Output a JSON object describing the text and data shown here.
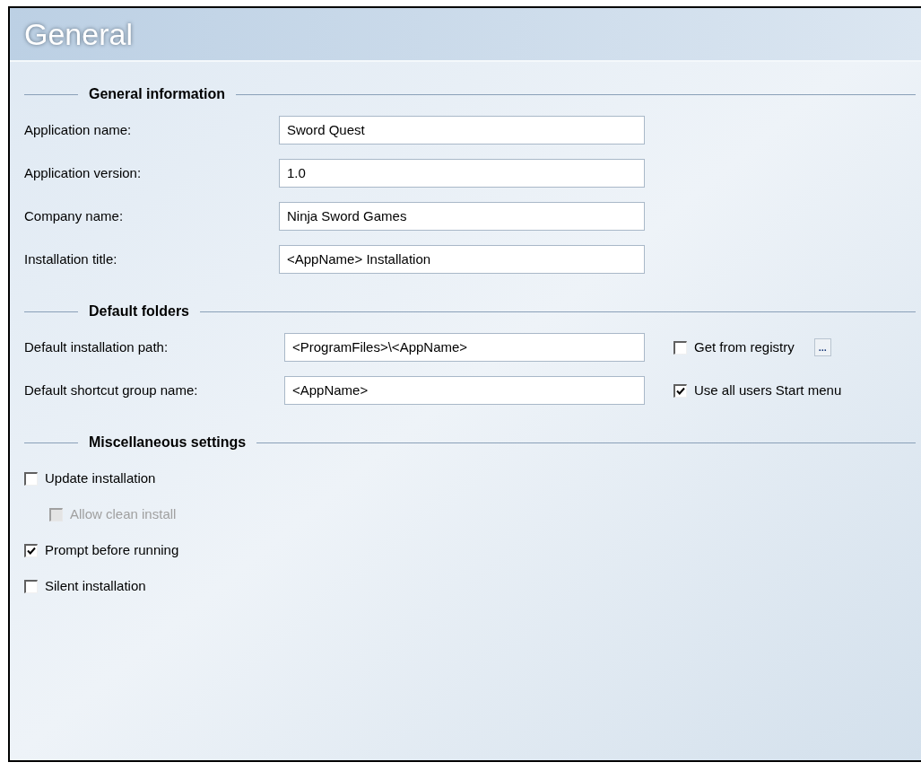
{
  "page": {
    "title": "General"
  },
  "general_information": {
    "heading": "General information",
    "fields": [
      {
        "label": "Application name:",
        "value": "Sword Quest"
      },
      {
        "label": "Application version:",
        "value": "1.0"
      },
      {
        "label": "Company name:",
        "value": "Ninja Sword Games"
      },
      {
        "label": "Installation title:",
        "value": "<AppName> Installation"
      }
    ]
  },
  "default_folders": {
    "heading": "Default folders",
    "rows": [
      {
        "label": "Default installation path:",
        "value": "<ProgramFiles>\\<AppName>",
        "option": {
          "label": "Get from registry",
          "checked": false
        },
        "button": "..."
      },
      {
        "label": "Default shortcut group name:",
        "value": "<AppName>",
        "option": {
          "label": "Use all users Start menu",
          "checked": true
        }
      }
    ]
  },
  "miscellaneous_settings": {
    "heading": "Miscellaneous settings",
    "options": [
      {
        "label": "Update installation",
        "checked": false,
        "disabled": false,
        "children": [
          {
            "label": "Allow clean install",
            "checked": false,
            "disabled": true
          }
        ]
      },
      {
        "label": "Prompt before running",
        "checked": true,
        "disabled": false
      },
      {
        "label": "Silent installation",
        "checked": false,
        "disabled": false
      }
    ]
  }
}
